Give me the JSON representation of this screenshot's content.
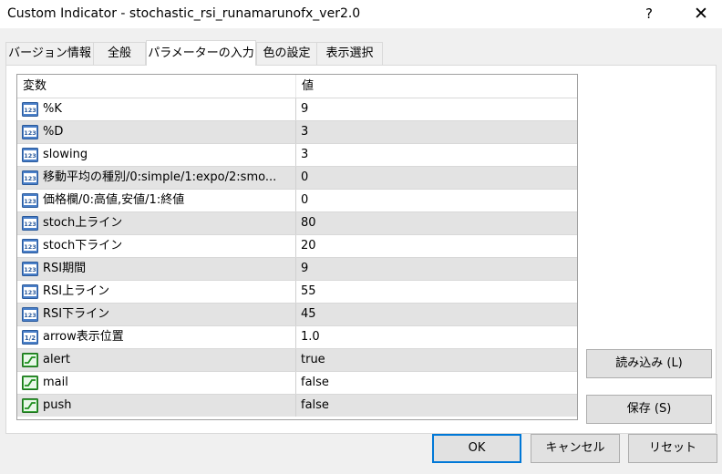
{
  "window": {
    "title": "Custom Indicator - stochastic_rsi_runamarunofx_ver2.0",
    "help_label": "?",
    "close_label": "✕"
  },
  "tabs": [
    {
      "label": "バージョン情報"
    },
    {
      "label": "全般"
    },
    {
      "label": "パラメーターの入力",
      "active": true
    },
    {
      "label": "色の設定"
    },
    {
      "label": "表示選択"
    }
  ],
  "grid": {
    "headers": {
      "variable": "変数",
      "value": "値"
    },
    "rows": [
      {
        "name": "%K",
        "value": "9",
        "icon": "integer-icon"
      },
      {
        "name": "%D",
        "value": "3",
        "icon": "integer-icon"
      },
      {
        "name": "slowing",
        "value": "3",
        "icon": "integer-icon"
      },
      {
        "name": "移動平均の種別/0:simple/1:expo/2:smo...",
        "value": "0",
        "icon": "integer-icon"
      },
      {
        "name": "価格欄/0:高値,安値/1:終値",
        "value": "0",
        "icon": "integer-icon"
      },
      {
        "name": "stoch上ライン",
        "value": "80",
        "icon": "integer-icon"
      },
      {
        "name": "stoch下ライン",
        "value": "20",
        "icon": "integer-icon"
      },
      {
        "name": "RSI期間",
        "value": "9",
        "icon": "integer-icon"
      },
      {
        "name": "RSI上ライン",
        "value": "55",
        "icon": "integer-icon"
      },
      {
        "name": "RSI下ライン",
        "value": "45",
        "icon": "integer-icon"
      },
      {
        "name": "arrow表示位置",
        "value": "1.0",
        "icon": "double-icon"
      },
      {
        "name": "alert",
        "value": "true",
        "icon": "boolean-icon"
      },
      {
        "name": "mail",
        "value": "false",
        "icon": "boolean-icon"
      },
      {
        "name": "push",
        "value": "false",
        "icon": "boolean-icon"
      }
    ]
  },
  "buttons": {
    "load": "読み込み (L)",
    "save": "保存 (S)",
    "ok": "OK",
    "cancel": "キャンセル",
    "reset": "リセット"
  },
  "icon_labels": {
    "integer": "123",
    "double": "1/2"
  },
  "colors": {
    "row_alt": "#e3e3e3",
    "default_button_border": "#0078d7",
    "integer_icon_bg": "#4a7fc8",
    "boolean_icon_bg": "#35a535"
  }
}
